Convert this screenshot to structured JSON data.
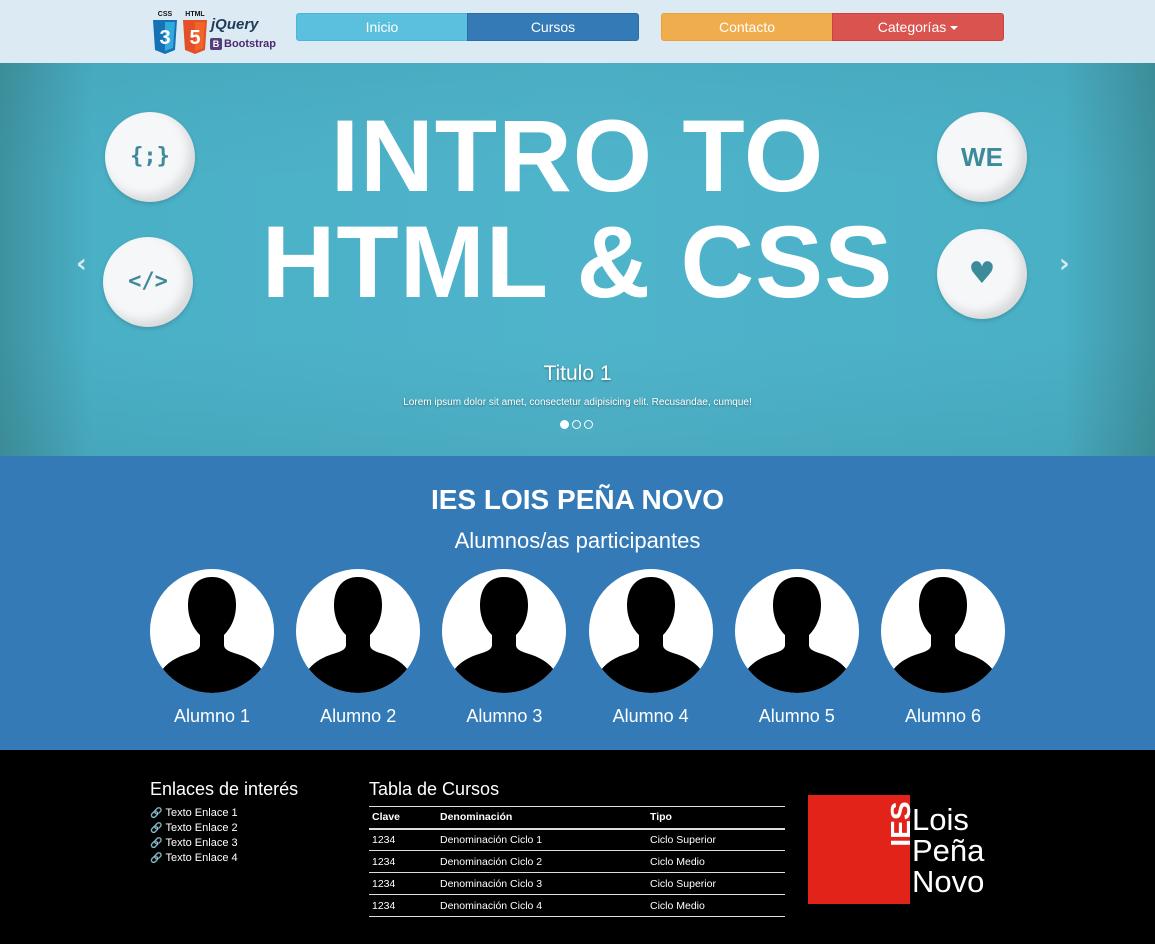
{
  "header": {
    "logos": {
      "css_label": "CSS",
      "css_number": "3",
      "html_label": "HTML",
      "html_number": "5",
      "jquery": "jQuery",
      "bootstrap_badge": "B",
      "bootstrap": "Bootstrap"
    },
    "nav": {
      "inicio": "Inicio",
      "cursos": "Cursos",
      "contacto": "Contacto",
      "categorias": "Categorías"
    }
  },
  "carousel": {
    "title_line1": "INTRO TO",
    "title_line2": "HTML & CSS",
    "badge_1": "{;}",
    "badge_2": "</>",
    "badge_3": "WE",
    "badge_4": "♥",
    "prev": "‹",
    "next": "›",
    "caption_title": "Titulo 1",
    "caption_text": "Lorem ipsum dolor sit amet, consectetur adipisicing elit. Recusandae, cumque!",
    "slide_count": 3,
    "active_slide": 1
  },
  "students": {
    "school": "IES LOIS PEÑA NOVO",
    "subtitle": "Alumnos/as participantes",
    "list": [
      "Alumno 1",
      "Alumno 2",
      "Alumno 3",
      "Alumno 4",
      "Alumno 5",
      "Alumno 6"
    ]
  },
  "footer": {
    "links_title": "Enlaces de interés",
    "links": [
      "Texto Enlace 1",
      "Texto Enlace 2",
      "Texto Enlace 3",
      "Texto Enlace 4"
    ],
    "table_title": "Tabla de Cursos",
    "table_headers": [
      "Clave",
      "Denominación",
      "Tipo"
    ],
    "table_rows": [
      [
        "1234",
        "Denominación Ciclo 1",
        "Ciclo Superior"
      ],
      [
        "1234",
        "Denominación Ciclo 2",
        "Ciclo Medio"
      ],
      [
        "1234",
        "Denominación Ciclo 3",
        "Ciclo Superior"
      ],
      [
        "1234",
        "Denominación Ciclo 4",
        "Ciclo Medio"
      ]
    ],
    "logo": {
      "ies": "IES",
      "line1": "Lois",
      "line2": "Peña",
      "line3": "Novo"
    }
  },
  "colors": {
    "header_bg": "#dbeaf3",
    "info": "#5bc0de",
    "primary": "#337ab7",
    "warning": "#f0ad4e",
    "danger": "#d9534f",
    "carousel_bg": "#4fb4cb",
    "logo_red": "#e2231a"
  }
}
